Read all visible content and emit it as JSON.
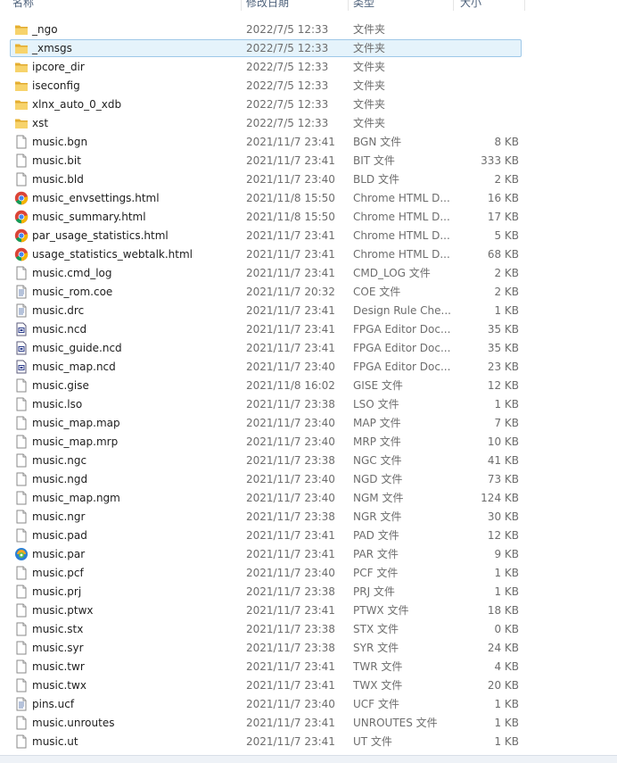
{
  "columns": {
    "name": "名称",
    "date": "修改日期",
    "type": "类型",
    "size": "大小"
  },
  "files": [
    {
      "name": "_ngo",
      "date": "2022/7/5 12:33",
      "type": "文件夹",
      "size": "",
      "icon": "folder-icon"
    },
    {
      "name": "_xmsgs",
      "date": "2022/7/5 12:33",
      "type": "文件夹",
      "size": "",
      "icon": "folder-icon",
      "selected": true
    },
    {
      "name": "ipcore_dir",
      "date": "2022/7/5 12:33",
      "type": "文件夹",
      "size": "",
      "icon": "folder-icon"
    },
    {
      "name": "iseconfig",
      "date": "2022/7/5 12:33",
      "type": "文件夹",
      "size": "",
      "icon": "folder-icon"
    },
    {
      "name": "xlnx_auto_0_xdb",
      "date": "2022/7/5 12:33",
      "type": "文件夹",
      "size": "",
      "icon": "folder-icon"
    },
    {
      "name": "xst",
      "date": "2022/7/5 12:33",
      "type": "文件夹",
      "size": "",
      "icon": "folder-icon"
    },
    {
      "name": "music.bgn",
      "date": "2021/11/7 23:41",
      "type": "BGN 文件",
      "size": "8 KB",
      "icon": "file-icon"
    },
    {
      "name": "music.bit",
      "date": "2021/11/7 23:41",
      "type": "BIT 文件",
      "size": "333 KB",
      "icon": "file-icon"
    },
    {
      "name": "music.bld",
      "date": "2021/11/7 23:40",
      "type": "BLD 文件",
      "size": "2 KB",
      "icon": "file-icon"
    },
    {
      "name": "music_envsettings.html",
      "date": "2021/11/8 15:50",
      "type": "Chrome HTML D...",
      "size": "16 KB",
      "icon": "chrome-icon"
    },
    {
      "name": "music_summary.html",
      "date": "2021/11/8 15:50",
      "type": "Chrome HTML D...",
      "size": "17 KB",
      "icon": "chrome-icon"
    },
    {
      "name": "par_usage_statistics.html",
      "date": "2021/11/7 23:41",
      "type": "Chrome HTML D...",
      "size": "5 KB",
      "icon": "chrome-icon"
    },
    {
      "name": "usage_statistics_webtalk.html",
      "date": "2021/11/7 23:41",
      "type": "Chrome HTML D...",
      "size": "68 KB",
      "icon": "chrome-icon"
    },
    {
      "name": "music.cmd_log",
      "date": "2021/11/7 23:41",
      "type": "CMD_LOG 文件",
      "size": "2 KB",
      "icon": "file-icon"
    },
    {
      "name": "music_rom.coe",
      "date": "2021/11/7 20:32",
      "type": "COE 文件",
      "size": "2 KB",
      "icon": "text-file-icon"
    },
    {
      "name": "music.drc",
      "date": "2021/11/7 23:41",
      "type": "Design Rule Che...",
      "size": "1 KB",
      "icon": "text-file-icon"
    },
    {
      "name": "music.ncd",
      "date": "2021/11/7 23:41",
      "type": "FPGA Editor Doc...",
      "size": "35 KB",
      "icon": "fpga-doc-icon"
    },
    {
      "name": "music_guide.ncd",
      "date": "2021/11/7 23:41",
      "type": "FPGA Editor Doc...",
      "size": "35 KB",
      "icon": "fpga-doc-icon"
    },
    {
      "name": "music_map.ncd",
      "date": "2021/11/7 23:40",
      "type": "FPGA Editor Doc...",
      "size": "23 KB",
      "icon": "fpga-doc-icon"
    },
    {
      "name": "music.gise",
      "date": "2021/11/8 16:02",
      "type": "GISE 文件",
      "size": "12 KB",
      "icon": "file-icon"
    },
    {
      "name": "music.lso",
      "date": "2021/11/7 23:38",
      "type": "LSO 文件",
      "size": "1 KB",
      "icon": "file-icon"
    },
    {
      "name": "music_map.map",
      "date": "2021/11/7 23:40",
      "type": "MAP 文件",
      "size": "7 KB",
      "icon": "file-icon"
    },
    {
      "name": "music_map.mrp",
      "date": "2021/11/7 23:40",
      "type": "MRP 文件",
      "size": "10 KB",
      "icon": "file-icon"
    },
    {
      "name": "music.ngc",
      "date": "2021/11/7 23:38",
      "type": "NGC 文件",
      "size": "41 KB",
      "icon": "file-icon"
    },
    {
      "name": "music.ngd",
      "date": "2021/11/7 23:40",
      "type": "NGD 文件",
      "size": "73 KB",
      "icon": "file-icon"
    },
    {
      "name": "music_map.ngm",
      "date": "2021/11/7 23:40",
      "type": "NGM 文件",
      "size": "124 KB",
      "icon": "file-icon"
    },
    {
      "name": "music.ngr",
      "date": "2021/11/7 23:38",
      "type": "NGR 文件",
      "size": "30 KB",
      "icon": "file-icon"
    },
    {
      "name": "music.pad",
      "date": "2021/11/7 23:41",
      "type": "PAD 文件",
      "size": "12 KB",
      "icon": "file-icon"
    },
    {
      "name": "music.par",
      "date": "2021/11/7 23:41",
      "type": "PAR 文件",
      "size": "9 KB",
      "icon": "par-app-icon"
    },
    {
      "name": "music.pcf",
      "date": "2021/11/7 23:40",
      "type": "PCF 文件",
      "size": "1 KB",
      "icon": "file-icon"
    },
    {
      "name": "music.prj",
      "date": "2021/11/7 23:38",
      "type": "PRJ 文件",
      "size": "1 KB",
      "icon": "file-icon"
    },
    {
      "name": "music.ptwx",
      "date": "2021/11/7 23:41",
      "type": "PTWX 文件",
      "size": "18 KB",
      "icon": "file-icon"
    },
    {
      "name": "music.stx",
      "date": "2021/11/7 23:38",
      "type": "STX 文件",
      "size": "0 KB",
      "icon": "file-icon"
    },
    {
      "name": "music.syr",
      "date": "2021/11/7 23:38",
      "type": "SYR 文件",
      "size": "24 KB",
      "icon": "file-icon"
    },
    {
      "name": "music.twr",
      "date": "2021/11/7 23:41",
      "type": "TWR 文件",
      "size": "4 KB",
      "icon": "file-icon"
    },
    {
      "name": "music.twx",
      "date": "2021/11/7 23:41",
      "type": "TWX 文件",
      "size": "20 KB",
      "icon": "file-icon"
    },
    {
      "name": "pins.ucf",
      "date": "2021/11/7 23:40",
      "type": "UCF 文件",
      "size": "1 KB",
      "icon": "text-file-icon"
    },
    {
      "name": "music.unroutes",
      "date": "2021/11/7 23:41",
      "type": "UNROUTES 文件",
      "size": "1 KB",
      "icon": "file-icon"
    },
    {
      "name": "music.ut",
      "date": "2021/11/7 23:41",
      "type": "UT 文件",
      "size": "1 KB",
      "icon": "file-icon"
    }
  ]
}
